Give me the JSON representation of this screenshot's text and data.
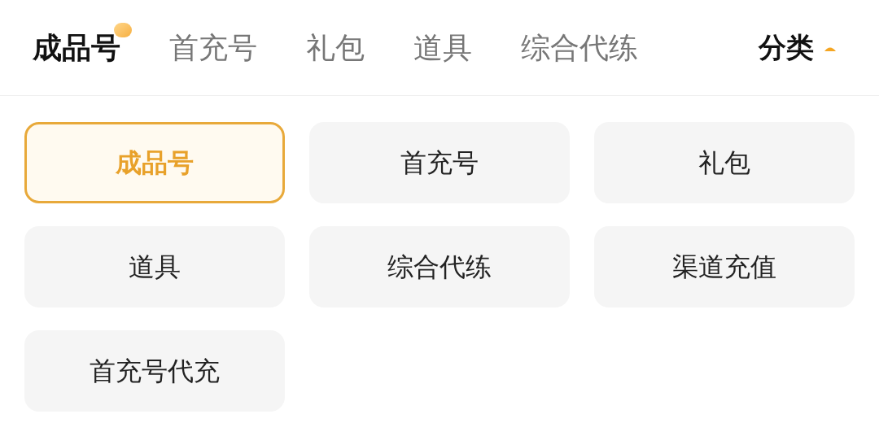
{
  "tabs": [
    {
      "label": "成品号",
      "selected": true
    },
    {
      "label": "首充号",
      "selected": false
    },
    {
      "label": "礼包",
      "selected": false
    },
    {
      "label": "道具",
      "selected": false
    },
    {
      "label": "综合代练",
      "selected": false
    }
  ],
  "category_toggle": {
    "label": "分类",
    "expanded": true
  },
  "categories": [
    {
      "label": "成品号",
      "selected": true
    },
    {
      "label": "首充号",
      "selected": false
    },
    {
      "label": "礼包",
      "selected": false
    },
    {
      "label": "道具",
      "selected": false
    },
    {
      "label": "综合代练",
      "selected": false
    },
    {
      "label": "渠道充值",
      "selected": false
    },
    {
      "label": "首充号代充",
      "selected": false
    }
  ]
}
